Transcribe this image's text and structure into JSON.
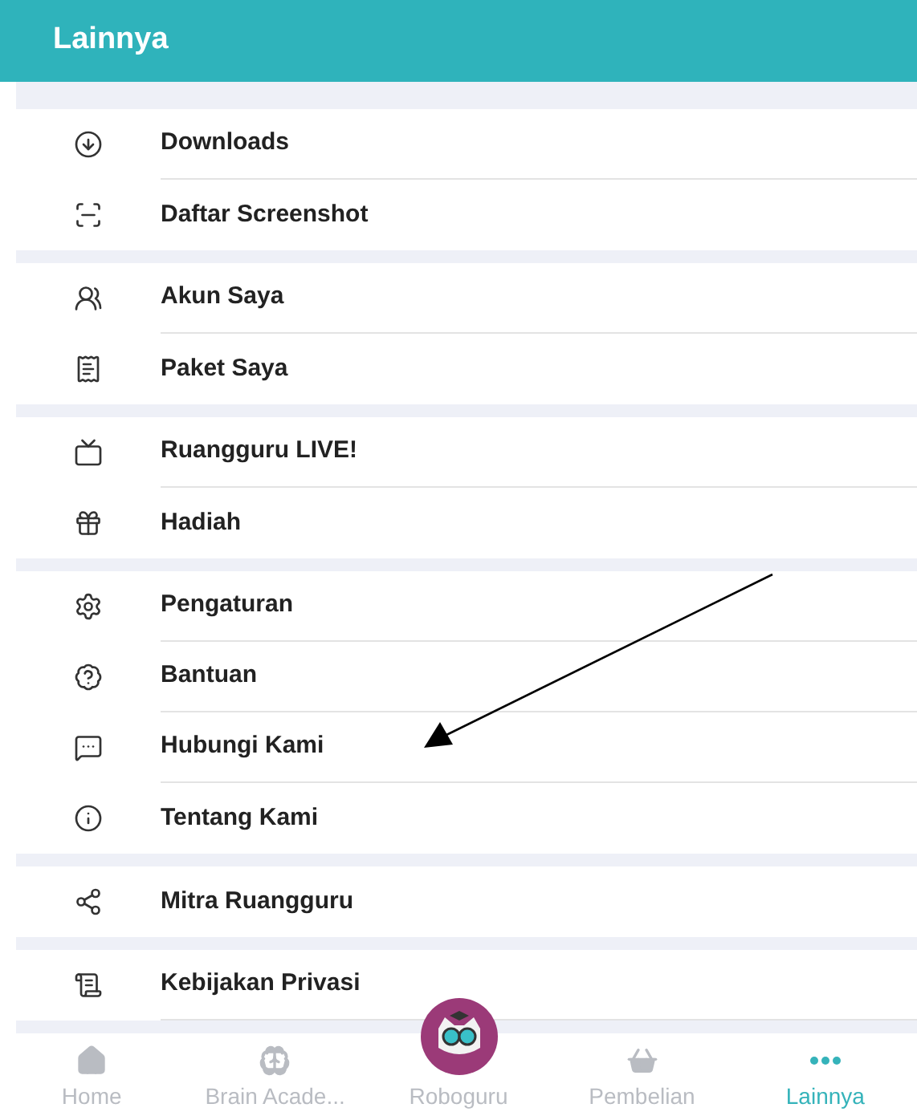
{
  "header": {
    "title": "Lainnya"
  },
  "sections": [
    {
      "items": [
        {
          "label": "Downloads"
        },
        {
          "label": "Daftar Screenshot"
        }
      ]
    },
    {
      "items": [
        {
          "label": "Akun Saya"
        },
        {
          "label": "Paket Saya"
        }
      ]
    },
    {
      "items": [
        {
          "label": "Ruangguru LIVE!"
        },
        {
          "label": "Hadiah"
        }
      ]
    },
    {
      "items": [
        {
          "label": "Pengaturan"
        },
        {
          "label": "Bantuan"
        },
        {
          "label": "Hubungi Kami"
        },
        {
          "label": "Tentang Kami"
        }
      ]
    },
    {
      "items": [
        {
          "label": "Mitra Ruangguru"
        }
      ]
    },
    {
      "items": [
        {
          "label": "Kebijakan Privasi"
        }
      ]
    }
  ],
  "bottom_nav": [
    {
      "label": "Home",
      "selected": false
    },
    {
      "label": "Brain Acade...",
      "selected": false
    },
    {
      "label": "Roboguru",
      "selected": false
    },
    {
      "label": "Pembelian",
      "selected": false
    },
    {
      "label": "Lainnya",
      "selected": true
    }
  ]
}
